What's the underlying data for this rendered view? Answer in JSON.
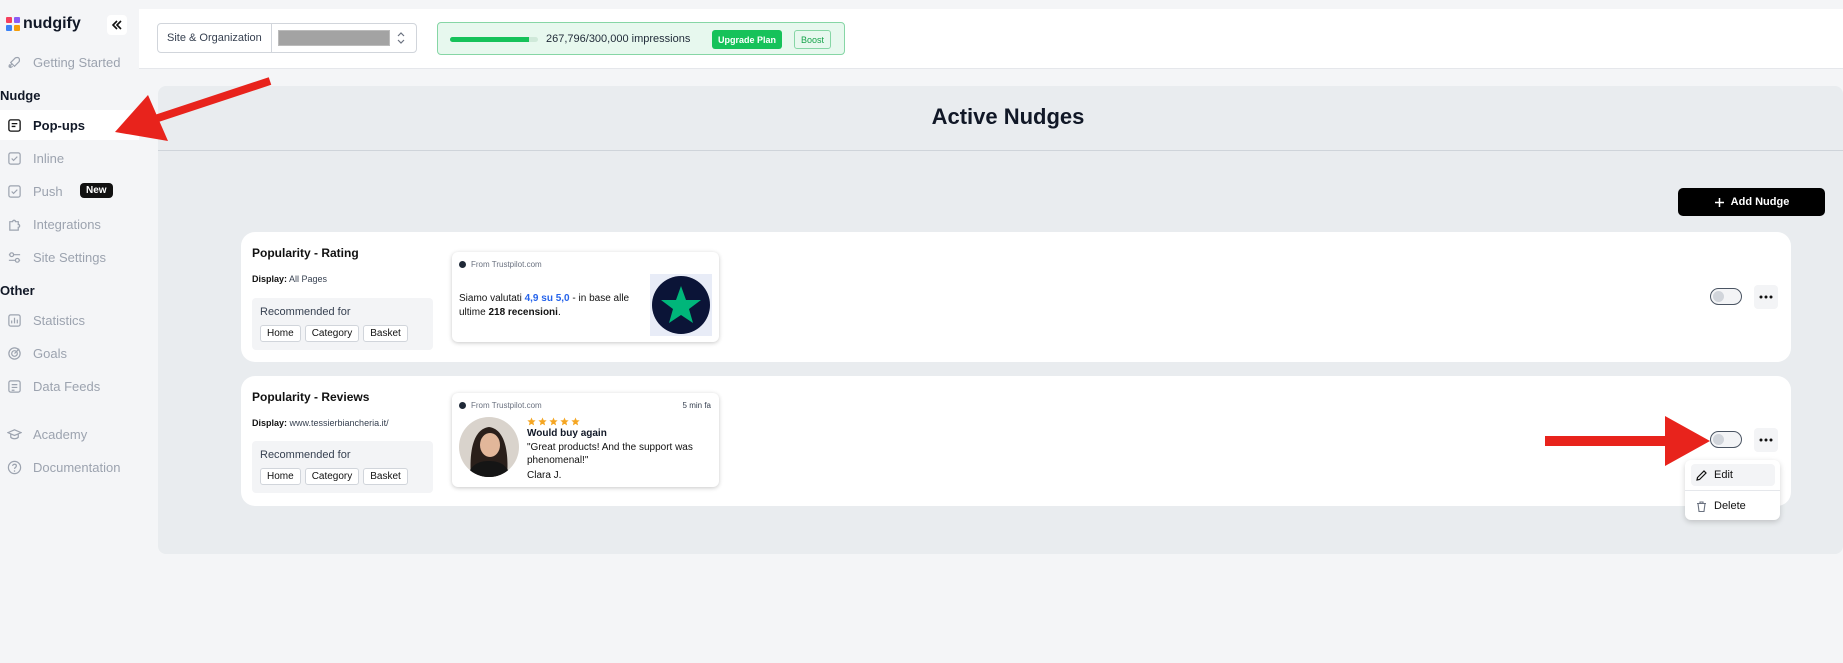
{
  "app": {
    "brand": "nudgify",
    "colors": {
      "accent_green": "#16c25a",
      "arrow_red": "#e8231c",
      "trustpilot_green": "#00b67a",
      "star_yellow": "#f5a623"
    }
  },
  "sidebar": {
    "collapse_icon": "double-chevron-left-icon",
    "top_item": {
      "label": "Getting Started",
      "icon": "rocket-icon"
    },
    "sections": [
      {
        "title": "Nudge",
        "items": [
          {
            "label": "Pop-ups",
            "icon": "popup-icon",
            "active": true
          },
          {
            "label": "Inline",
            "icon": "inline-icon"
          },
          {
            "label": "Push",
            "icon": "push-icon",
            "badge": "New"
          },
          {
            "label": "Integrations",
            "icon": "puzzle-icon"
          },
          {
            "label": "Site Settings",
            "icon": "sliders-icon"
          }
        ]
      },
      {
        "title": "Other",
        "items": [
          {
            "label": "Statistics",
            "icon": "chart-icon"
          },
          {
            "label": "Goals",
            "icon": "target-icon"
          },
          {
            "label": "Data Feeds",
            "icon": "feed-icon"
          }
        ]
      }
    ],
    "bottom_items": [
      {
        "label": "Academy",
        "icon": "graduation-cap-icon"
      },
      {
        "label": "Documentation",
        "icon": "help-circle-icon"
      }
    ]
  },
  "topbar": {
    "site_selector_label": "Site & Organization",
    "impressions_text": "267,796/300,000 impressions",
    "impressions_used": 267796,
    "impressions_limit": 300000,
    "upgrade_label": "Upgrade Plan",
    "boost_label": "Boost"
  },
  "main": {
    "title": "Active Nudges",
    "add_label": "Add Nudge",
    "nudges": [
      {
        "title": "Popularity - Rating",
        "display_label": "Display:",
        "display_value": "All Pages",
        "recommended_label": "Recommended for",
        "tags": [
          "Home",
          "Category",
          "Basket"
        ],
        "preview": {
          "source": "From Trustpilot.com",
          "text_1": "Siamo valutati ",
          "score": "4,9 su 5,0",
          "text_2": " - in base alle ultime ",
          "count": "218 recensioni",
          "text_3": "."
        },
        "enabled": false
      },
      {
        "title": "Popularity - Reviews",
        "display_label": "Display:",
        "display_value": "www.tessierbiancheria.it/",
        "recommended_label": "Recommended for",
        "tags": [
          "Home",
          "Category",
          "Basket"
        ],
        "preview": {
          "source": "From Trustpilot.com",
          "time": "5 min fa",
          "stars": 5,
          "heading": "Would buy again",
          "body": "\"Great products! And the support was phenomenal!\"",
          "author": "Clara J."
        },
        "enabled": false
      }
    ],
    "menu": {
      "edit_label": "Edit",
      "delete_label": "Delete"
    }
  }
}
